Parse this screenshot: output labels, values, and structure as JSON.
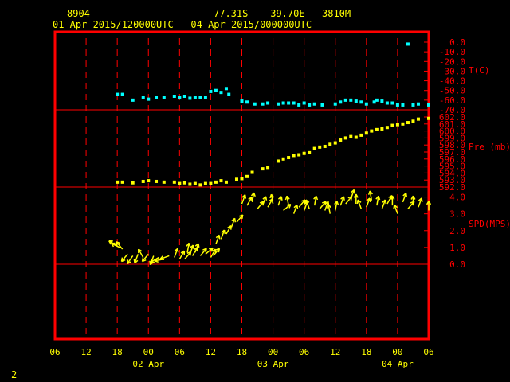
{
  "header": {
    "station": "8904",
    "lat": "77.31S",
    "lon": "-39.70E",
    "elev": "3810M",
    "period": "01 Apr 2015/120000UTC - 04 Apr 2015/000000UTC"
  },
  "page_number": "2",
  "colors": {
    "frame": "#ff0000",
    "axis_text": "#ff0000",
    "time_text": "#ffff00",
    "temp": "#00ffff",
    "pressure": "#ffff00",
    "wind": "#ffff00",
    "background": "#000000"
  },
  "chart_data": [
    {
      "type": "scatter",
      "panel": "temperature",
      "ylabel": "T(C)",
      "ylim": [
        -70,
        0
      ],
      "yticks": [
        "0.0",
        "-10.0",
        "-20.0",
        "-30.0",
        "-40.0",
        "-50.0",
        "-60.0",
        "-70.0"
      ],
      "x_unit": "hours since 01 Apr 2015 06UTC",
      "x": [
        12,
        13,
        15,
        17,
        18,
        19.5,
        21,
        23,
        24,
        25,
        26,
        27,
        28,
        29,
        30,
        31,
        32,
        33,
        33.5,
        36,
        37,
        38.5,
        40,
        41,
        43,
        44,
        45,
        46,
        47,
        48,
        49,
        50,
        51.5,
        54,
        55,
        56,
        57,
        58,
        59,
        60,
        61.5,
        62,
        63,
        64,
        65,
        66,
        67,
        68,
        69,
        70,
        72
      ],
      "y": [
        -54,
        -54,
        -60,
        -57,
        -59,
        -57,
        -57,
        -56,
        -57,
        -56,
        -58,
        -57,
        -57,
        -57,
        -51,
        -50,
        -52,
        -48,
        -54,
        -61,
        -62,
        -64,
        -64,
        -63,
        -64,
        -63,
        -63,
        -63,
        -65,
        -63,
        -65,
        -64,
        -65,
        -64,
        -62,
        -60,
        -60,
        -61,
        -62,
        -64,
        -62,
        -60,
        -61,
        -63,
        -63,
        -65,
        -65,
        -2,
        -65,
        -64,
        -65
      ]
    },
    {
      "type": "scatter",
      "panel": "pressure",
      "ylabel": "Pre (mb)",
      "ylim": [
        592,
        602
      ],
      "yticks": [
        "602.0",
        "601.0",
        "600.0",
        "599.0",
        "598.0",
        "597.0",
        "596.0",
        "595.0",
        "594.0",
        "593.0",
        "592.0"
      ],
      "x": [
        12,
        13,
        15,
        17,
        18,
        19.5,
        21,
        23,
        24,
        25,
        26,
        27,
        28,
        29,
        30,
        31,
        32,
        33,
        35,
        36,
        37,
        38,
        40,
        41,
        43,
        44,
        45,
        46,
        47,
        48,
        49,
        50,
        51,
        52,
        53,
        54,
        55,
        56,
        57,
        58,
        59,
        60,
        61,
        62,
        63,
        64,
        65,
        66,
        67,
        68,
        69,
        70,
        72
      ],
      "y": [
        592.7,
        592.7,
        592.6,
        592.8,
        592.9,
        592.8,
        592.7,
        592.7,
        592.5,
        592.6,
        592.4,
        592.5,
        592.3,
        592.5,
        592.5,
        592.7,
        592.9,
        592.7,
        593.1,
        593.2,
        593.5,
        594.1,
        594.6,
        594.8,
        595.7,
        596.0,
        596.2,
        596.5,
        596.6,
        596.8,
        596.9,
        597.5,
        597.7,
        597.8,
        598.1,
        598.3,
        598.7,
        599.0,
        599.2,
        599.1,
        599.4,
        599.7,
        600.0,
        600.2,
        600.3,
        600.5,
        600.8,
        600.9,
        601.0,
        601.2,
        601.4,
        601.7,
        601.8
      ]
    },
    {
      "type": "scatter",
      "panel": "wind",
      "ylabel": "SPD(MPS)",
      "ylim": [
        0,
        4.5
      ],
      "yticks": [
        "4.0",
        "3.0",
        "2.0",
        "1.0",
        "0.0"
      ],
      "x": [
        12,
        12.5,
        13,
        14,
        15,
        16,
        17,
        18,
        19,
        20,
        21,
        22,
        23,
        24,
        25,
        25.5,
        26,
        26.5,
        27,
        28,
        29,
        30,
        30.5,
        31,
        32,
        33,
        34,
        35,
        36,
        37,
        38,
        39,
        40,
        41,
        42,
        43,
        44,
        45,
        46,
        47,
        48,
        49,
        50,
        51,
        52,
        53,
        54,
        55,
        56,
        57,
        58,
        59,
        60,
        61,
        62,
        63,
        64,
        65,
        66,
        67,
        68,
        69,
        70,
        72
      ],
      "y": [
        1.1,
        1.0,
        0.9,
        0.6,
        0.5,
        0.6,
        0.4,
        0.6,
        0.5,
        0.4,
        0.3,
        0.5,
        0.4,
        0.3,
        0.3,
        0.7,
        0.6,
        0.5,
        0.7,
        0.5,
        0.6,
        0.4,
        0.5,
        1.2,
        1.5,
        1.8,
        2.2,
        2.5,
        3.6,
        3.5,
        3.7,
        3.3,
        3.5,
        3.4,
        3.6,
        3.5,
        3.2,
        3.5,
        3.0,
        3.4,
        3.2,
        3.3,
        3.5,
        3.3,
        3.2,
        3.0,
        3.2,
        3.5,
        3.6,
        3.9,
        3.6,
        3.3,
        3.4,
        3.8,
        3.5,
        3.3,
        3.6,
        3.5,
        3.0,
        3.7,
        3.3,
        3.5,
        3.4,
        3.2
      ],
      "dir": [
        120,
        115,
        140,
        40,
        35,
        20,
        150,
        40,
        20,
        60,
        80,
        70,
        200,
        210,
        220,
        190,
        200,
        210,
        200,
        220,
        230,
        210,
        220,
        200,
        200,
        210,
        200,
        220,
        200,
        210,
        190,
        220,
        200,
        210,
        170,
        200,
        230,
        170,
        200,
        220,
        200,
        160,
        190,
        220,
        200,
        170,
        190,
        200,
        220,
        200,
        180,
        160,
        200,
        170,
        190,
        200,
        210,
        180,
        160,
        200,
        220,
        180,
        200,
        180
      ]
    }
  ],
  "x_axis": {
    "ticks": [
      "06",
      "12",
      "18",
      "00",
      "06",
      "12",
      "18",
      "00",
      "06",
      "12",
      "18",
      "00",
      "06"
    ],
    "tick_hours": [
      0,
      6,
      12,
      18,
      24,
      30,
      36,
      42,
      48,
      54,
      60,
      66,
      72
    ],
    "days": [
      {
        "label": "02 Apr",
        "hour": 18
      },
      {
        "label": "03 Apr",
        "hour": 42
      },
      {
        "label": "04 Apr",
        "hour": 66
      }
    ]
  }
}
